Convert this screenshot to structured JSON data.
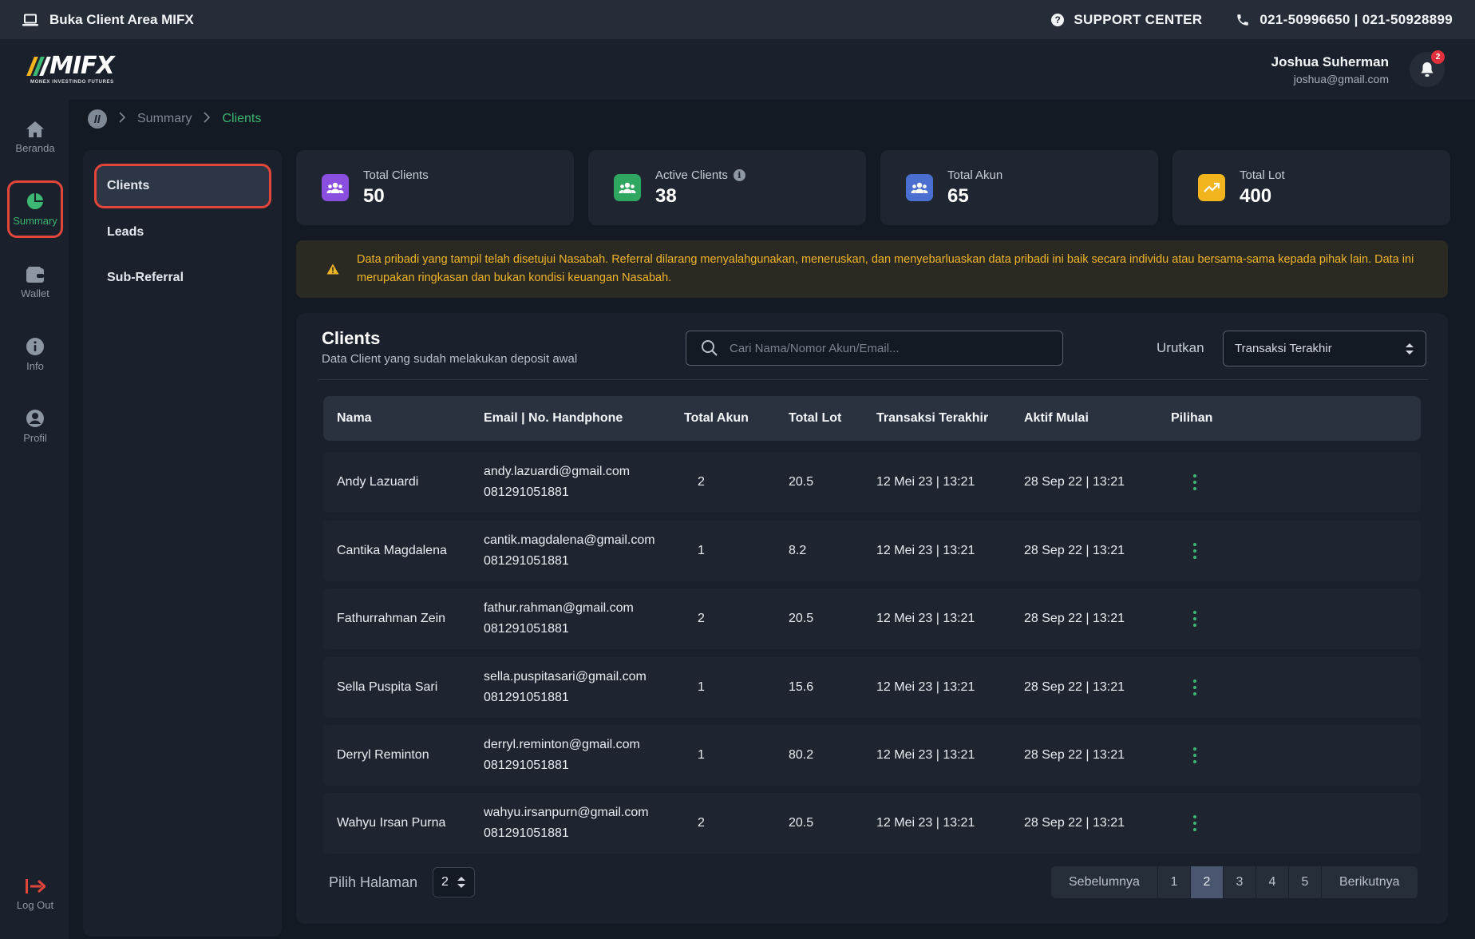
{
  "topbar": {
    "open_client_area": "Buka Client Area MIFX",
    "support_center": "SUPPORT CENTER",
    "phones": "021-50996650 | 021-50928899"
  },
  "header": {
    "logo_text": "MIFX",
    "logo_sub": "MONEX INVESTINDO FUTURES",
    "user_name": "Joshua Suherman",
    "user_email": "joshua@gmail.com",
    "notification_count": "2"
  },
  "rail": {
    "items": [
      {
        "label": "Beranda",
        "icon": "home-icon"
      },
      {
        "label": "Summary",
        "icon": "pie-chart-icon"
      },
      {
        "label": "Wallet",
        "icon": "wallet-icon"
      },
      {
        "label": "Info",
        "icon": "info-icon"
      },
      {
        "label": "Profil",
        "icon": "profile-icon"
      }
    ],
    "logout": "Log Out"
  },
  "breadcrumb": {
    "items": [
      "Summary",
      "Clients"
    ]
  },
  "subnav": {
    "items": [
      "Clients",
      "Leads",
      "Sub-Referral"
    ]
  },
  "stats": [
    {
      "label": "Total Clients",
      "value": "50",
      "color": "#8b4fe0"
    },
    {
      "label": "Active Clients",
      "value": "38",
      "color": "#2fa760"
    },
    {
      "label": "Total Akun",
      "value": "65",
      "color": "#4a6fd1"
    },
    {
      "label": "Total Lot",
      "value": "400",
      "color": "#f2b51d"
    }
  ],
  "notice": "Data pribadi yang tampil telah disetujui Nasabah. Referral dilarang menyalahgunakan, meneruskan, dan menyebarluaskan data pribadi ini baik secara individu atau bersama-sama kepada pihak lain. Data ini merupakan ringkasan dan bukan kondisi keuangan Nasabah.",
  "clients": {
    "title": "Clients",
    "subtitle": "Data Client yang sudah melakukan deposit awal",
    "search_placeholder": "Cari Nama/Nomor Akun/Email...",
    "sort_label": "Urutkan",
    "sort_value": "Transaksi Terakhir",
    "columns": [
      "Nama",
      "Email | No. Handphone",
      "Total Akun",
      "Total Lot",
      "Transaksi Terakhir",
      "Aktif Mulai",
      "Pilihan"
    ],
    "rows": [
      {
        "name": "Andy Lazuardi",
        "email": "andy.lazuardi@gmail.com",
        "phone": "081291051881",
        "akun": "2",
        "lot": "20.5",
        "last": "12 Mei 23 | 13:21",
        "since": "28 Sep 22 | 13:21"
      },
      {
        "name": "Cantika Magdalena",
        "email": "cantik.magdalena@gmail.com",
        "phone": "081291051881",
        "akun": "1",
        "lot": "8.2",
        "last": "12 Mei 23 | 13:21",
        "since": "28 Sep 22 | 13:21"
      },
      {
        "name": "Fathurrahman Zein",
        "email": "fathur.rahman@gmail.com",
        "phone": "081291051881",
        "akun": "2",
        "lot": "20.5",
        "last": "12 Mei 23 | 13:21",
        "since": "28 Sep 22 | 13:21"
      },
      {
        "name": "Sella Puspita Sari",
        "email": "sella.puspitasari@gmail.com",
        "phone": "081291051881",
        "akun": "1",
        "lot": "15.6",
        "last": "12 Mei 23 | 13:21",
        "since": "28 Sep 22 | 13:21"
      },
      {
        "name": "Derryl Reminton",
        "email": "derryl.reminton@gmail.com",
        "phone": "081291051881",
        "akun": "1",
        "lot": "80.2",
        "last": "12 Mei 23 | 13:21",
        "since": "28 Sep 22 | 13:21"
      },
      {
        "name": "Wahyu Irsan Purna",
        "email": "wahyu.irsanpurn@gmail.com",
        "phone": "081291051881",
        "akun": "2",
        "lot": "20.5",
        "last": "12 Mei 23 | 13:21",
        "since": "28 Sep 22 | 13:21"
      }
    ]
  },
  "pagination": {
    "label": "Pilih Halaman",
    "selected": "2",
    "prev": "Sebelumnya",
    "next": "Berikutnya",
    "pages": [
      "1",
      "2",
      "3",
      "4",
      "5"
    ]
  },
  "colors": {
    "accent_green": "#3db873",
    "highlight_red": "#e2453a",
    "warning": "#f0b428"
  }
}
